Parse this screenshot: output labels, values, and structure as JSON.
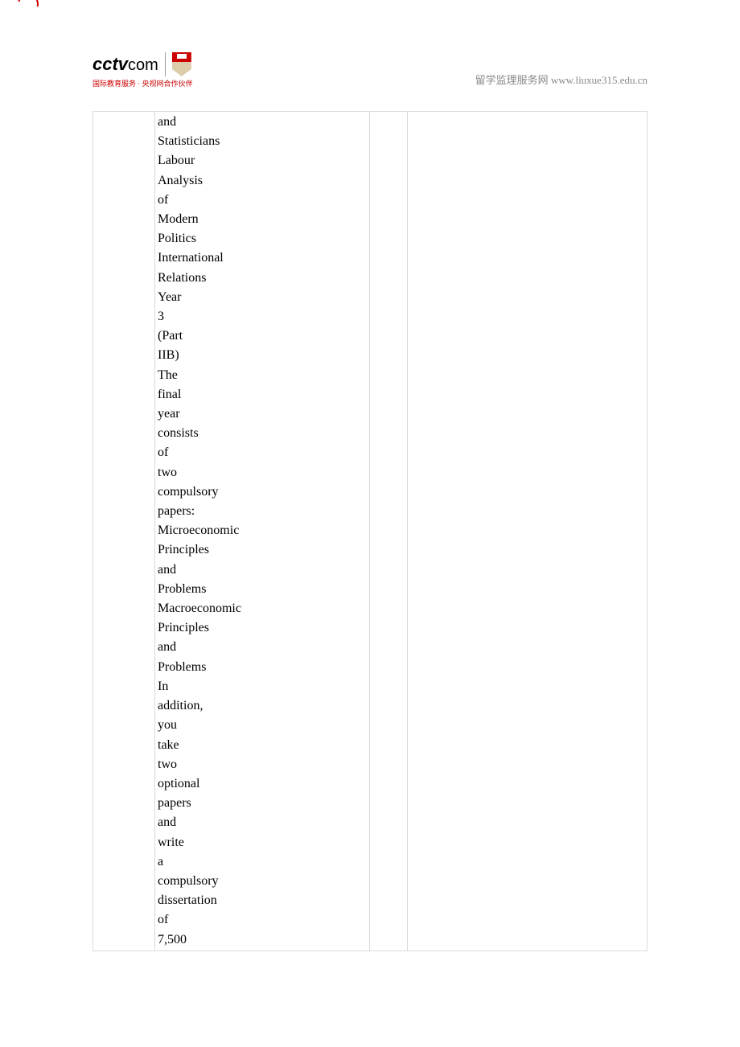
{
  "header": {
    "logo_main": "cctv",
    "logo_suffix": "com",
    "logo_subtitle": "国际教育服务 · 央视网合作伙伴",
    "right_label": "留学监理服务网",
    "right_url": "www.liuxue315.edu.cn"
  },
  "table": {
    "col1": "",
    "col2_words": [
      "and",
      "Statisticians",
      "Labour",
      "Analysis",
      "of",
      "Modern",
      "Politics",
      "International",
      "Relations",
      "Year",
      "3",
      "(Part",
      "IIB)",
      "The",
      "final",
      "year",
      "consists",
      "of",
      "two",
      "compulsory",
      "papers:",
      "Microeconomic",
      "Principles",
      "and",
      "Problems",
      "Macroeconomic",
      "Principles",
      "and",
      "Problems",
      "In",
      "addition,",
      "you",
      "take",
      "two",
      "optional",
      "papers",
      "and",
      "write",
      "a",
      "compulsory",
      "dissertation",
      "of",
      "7,500"
    ],
    "col3": "",
    "col4": ""
  }
}
